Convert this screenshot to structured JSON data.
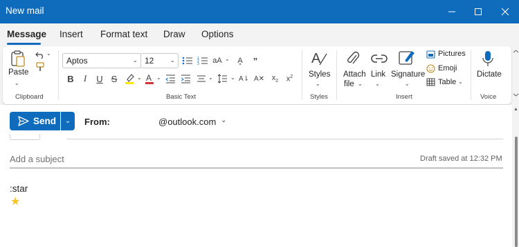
{
  "window": {
    "title": "New mail"
  },
  "tabs": [
    {
      "label": "Message",
      "active": true
    },
    {
      "label": "Insert"
    },
    {
      "label": "Format text"
    },
    {
      "label": "Draw"
    },
    {
      "label": "Options"
    }
  ],
  "ribbon": {
    "clipboard": {
      "paste_label": "Paste",
      "group_label": "Clipboard"
    },
    "basic_text": {
      "font_name": "Aptos",
      "font_size": "12",
      "group_label": "Basic Text"
    },
    "styles": {
      "label": "Styles",
      "group_label": "Styles"
    },
    "insert": {
      "attach_label_1": "Attach",
      "attach_label_2": "file",
      "link_label": "Link",
      "signature_label": "Signature",
      "pictures_label": "Pictures",
      "emoji_label": "Emoji",
      "table_label": "Table",
      "group_label": "Insert"
    },
    "voice": {
      "dictate_label": "Dictate",
      "group_label": "Voice"
    }
  },
  "compose": {
    "send_label": "Send",
    "from_label": "From:",
    "from_value": "@outlook.com",
    "subject_placeholder": "Add a subject",
    "draft_status": "Draft saved at 12:32 PM",
    "body_text": ":star",
    "body_emoji": "★"
  },
  "colors": {
    "accent": "#0f6cbd",
    "star": "#f7c325",
    "highlight": "#ffe600",
    "font_color": "#d13438"
  }
}
